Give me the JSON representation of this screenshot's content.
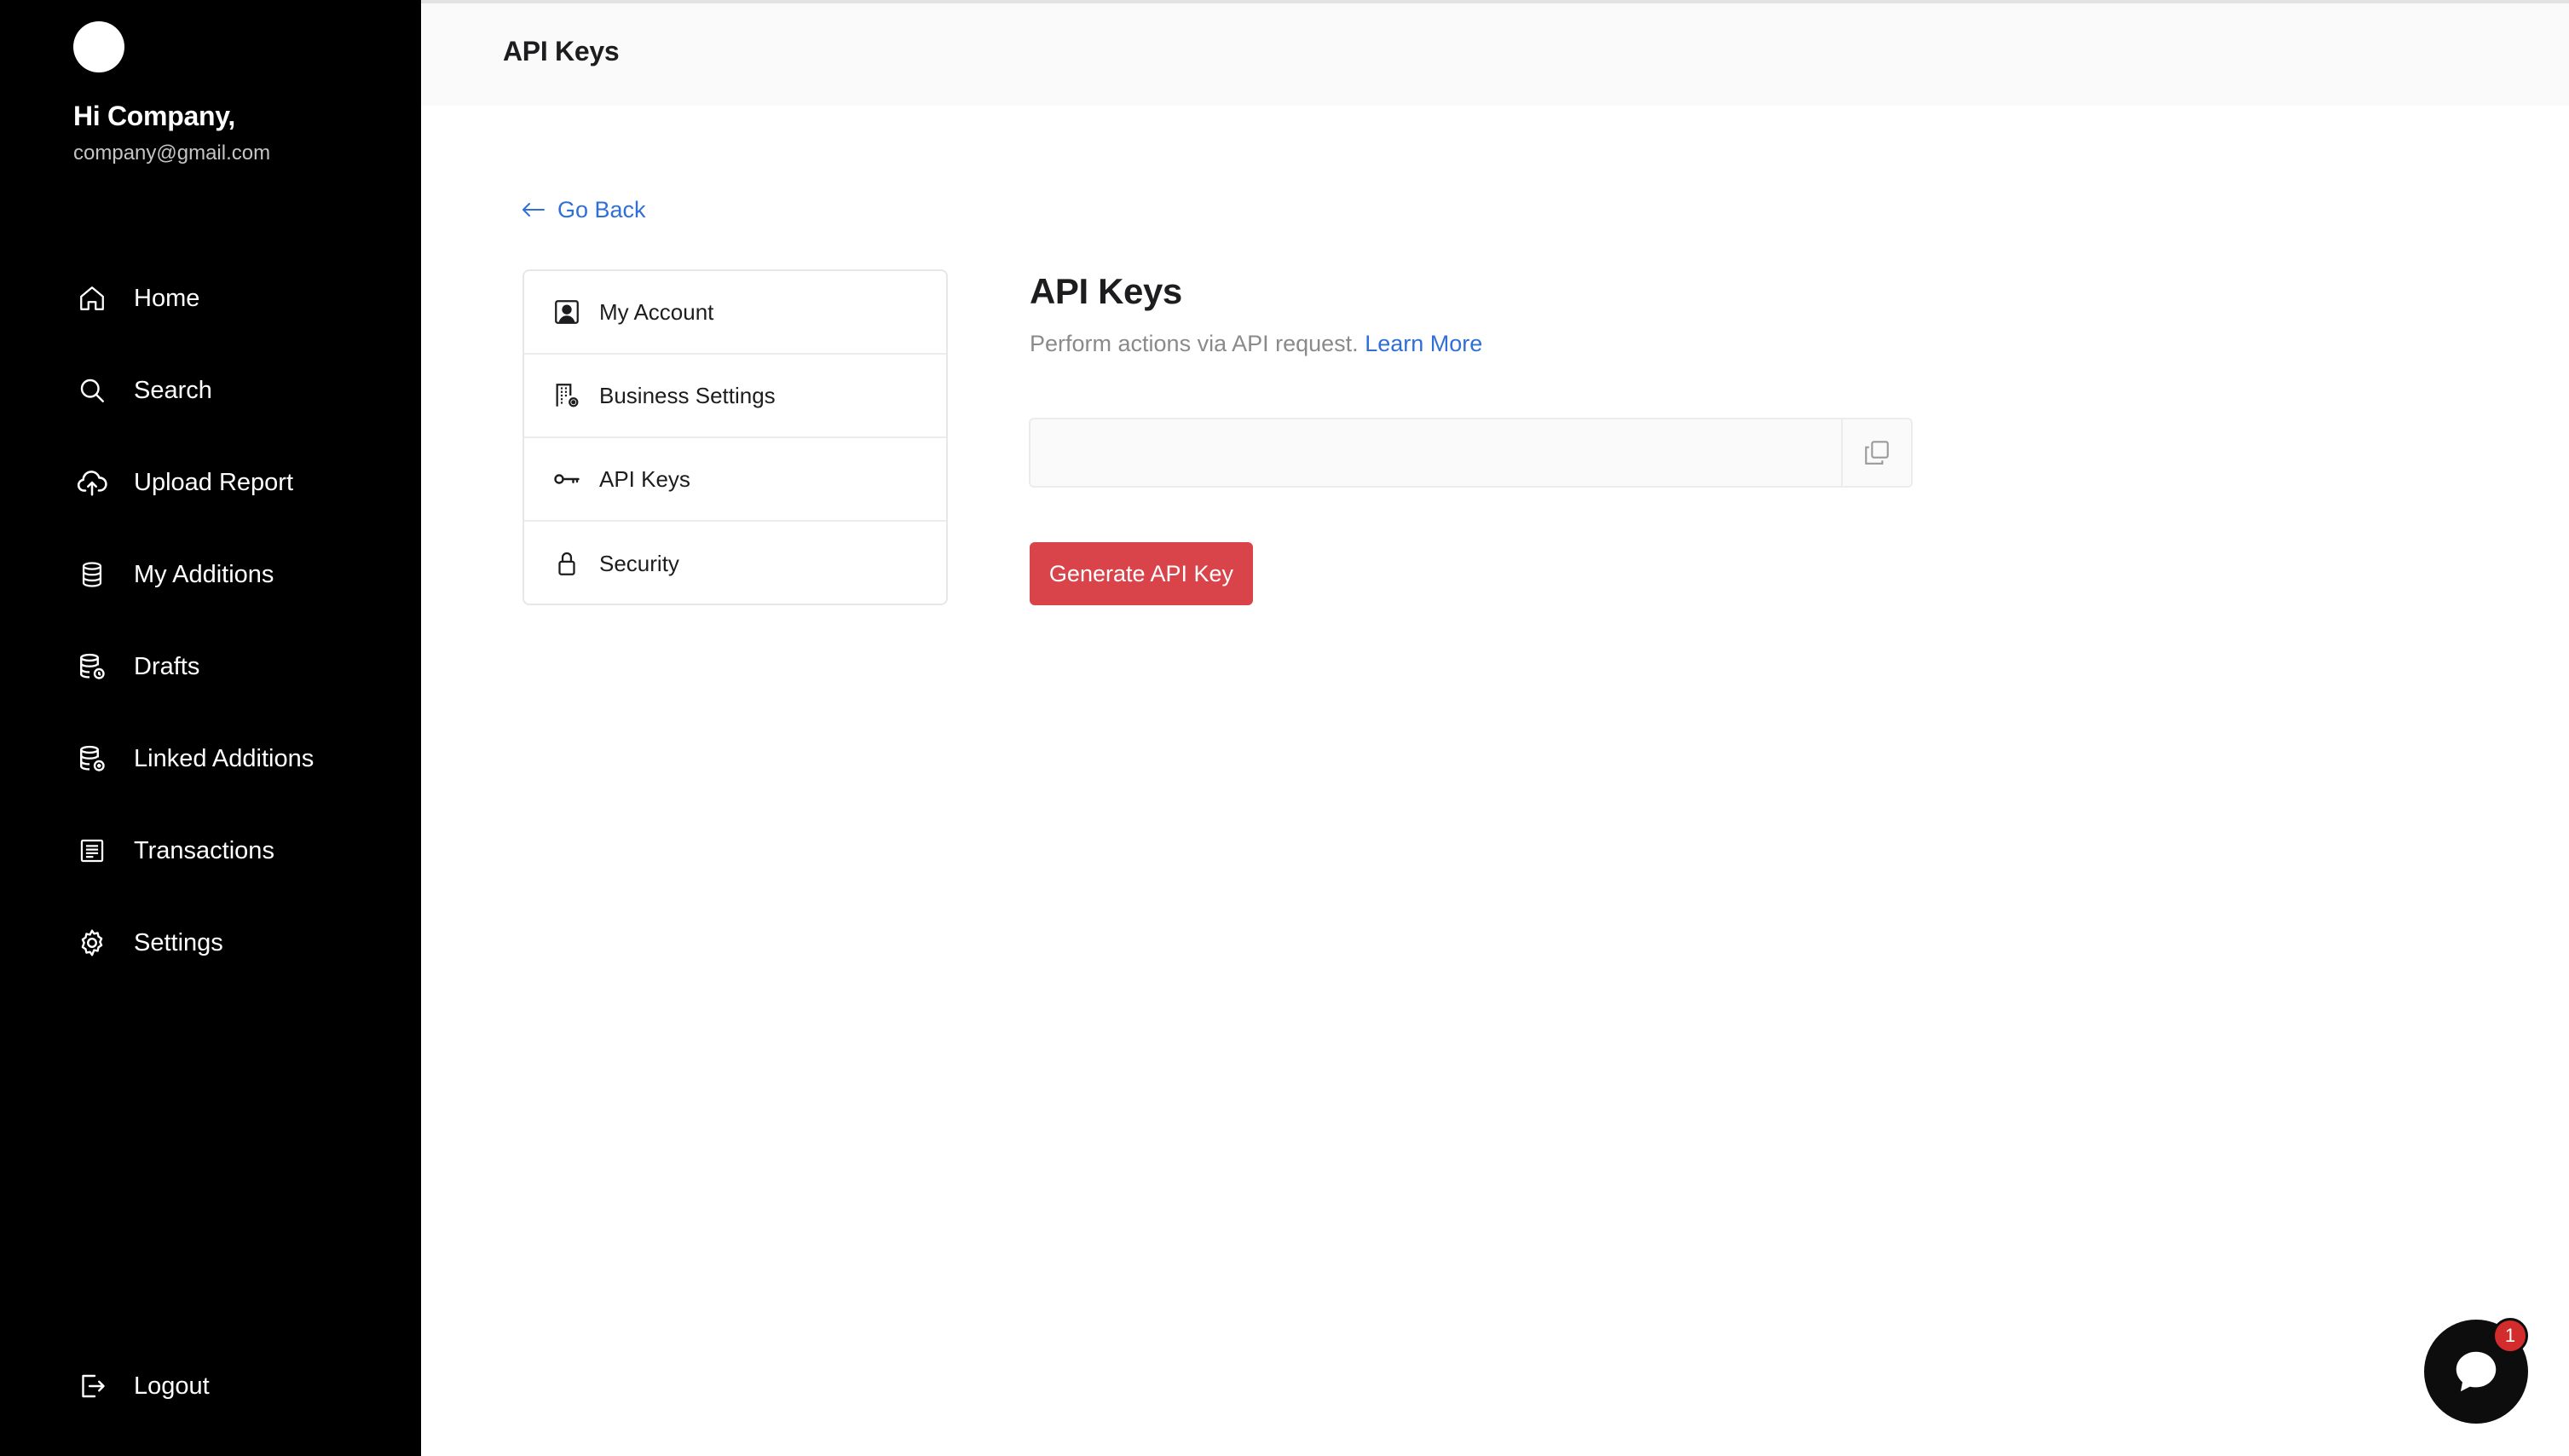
{
  "sidebar": {
    "greeting": "Hi Company,",
    "email": "company@gmail.com",
    "items": [
      {
        "label": "Home",
        "icon": "home-icon"
      },
      {
        "label": "Search",
        "icon": "search-icon"
      },
      {
        "label": "Upload Report",
        "icon": "cloud-upload-icon"
      },
      {
        "label": "My Additions",
        "icon": "database-icon"
      },
      {
        "label": "Drafts",
        "icon": "database-draft-icon"
      },
      {
        "label": "Linked Additions",
        "icon": "database-link-icon"
      },
      {
        "label": "Transactions",
        "icon": "receipt-icon"
      },
      {
        "label": "Settings",
        "icon": "gear-icon"
      }
    ],
    "logout": {
      "label": "Logout",
      "icon": "logout-icon"
    }
  },
  "header": {
    "title": "API Keys"
  },
  "back": {
    "label": "Go Back"
  },
  "settings_menu": [
    {
      "label": "My Account",
      "icon": "user-square-icon"
    },
    {
      "label": "Business Settings",
      "icon": "building-gear-icon"
    },
    {
      "label": "API Keys",
      "icon": "key-icon"
    },
    {
      "label": "Security",
      "icon": "lock-icon"
    }
  ],
  "content": {
    "title": "API Keys",
    "description": "Perform actions via API request.",
    "learn_more": "Learn More",
    "api_key_value": "",
    "generate_label": "Generate API Key"
  },
  "chat": {
    "badge_count": "1"
  },
  "colors": {
    "sidebar_bg": "#000000",
    "accent_link": "#2f6fd6",
    "primary_button": "#d9434a",
    "badge": "#d22c2c"
  }
}
